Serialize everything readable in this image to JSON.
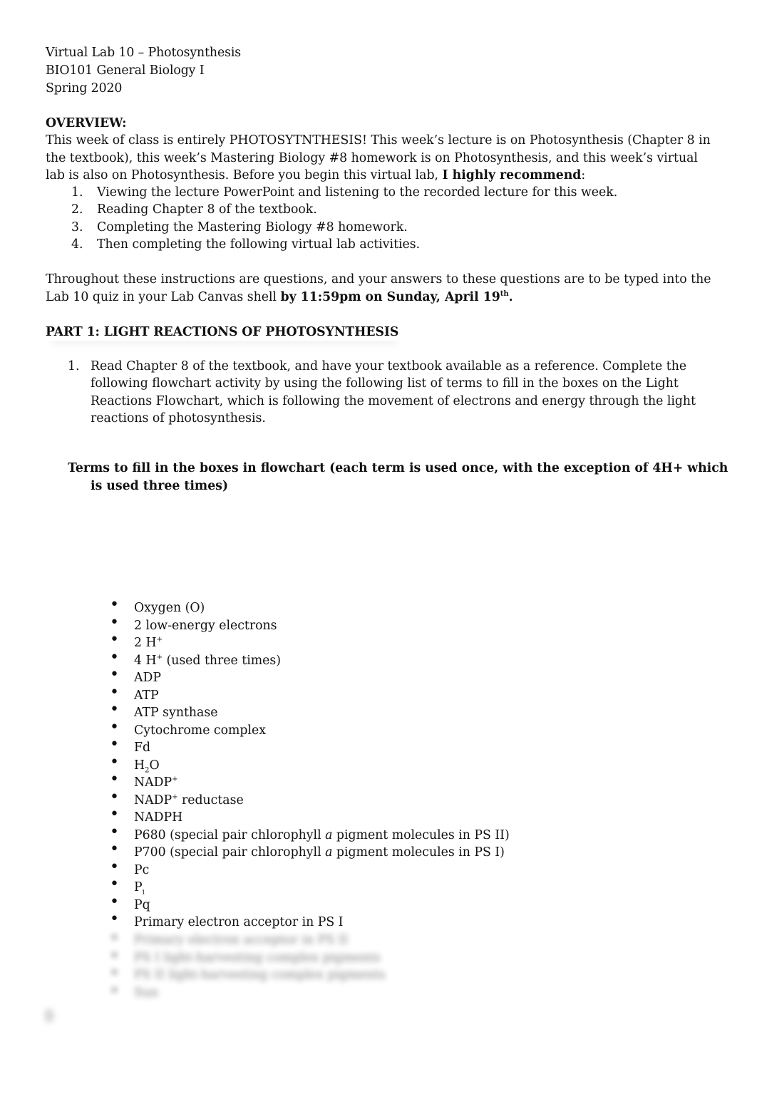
{
  "header": {
    "title": "Virtual Lab 10 – Photosynthesis",
    "course": "BIO101 General Biology I",
    "term": "Spring 2020"
  },
  "overview": {
    "heading": "OVERVIEW:",
    "intro_text": "This week of class is entirely PHOTOSYTNTHESIS! This week’s lecture is on Photosynthesis (Chapter 8 in the textbook), this week’s Mastering Biology #8 homework is on Photosynthesis, and this week’s virtual lab is also on Photosynthesis.  Before you begin this virtual lab, ",
    "intro_bold": "I highly recommend",
    "intro_end": ":",
    "steps": [
      {
        "num": "1.",
        "text": "Viewing the lecture PowerPoint and listening to the recorded lecture for this week."
      },
      {
        "num": "2.",
        "text": "Reading Chapter 8 of the textbook."
      },
      {
        "num": "3.",
        "text": "Completing the Mastering Biology #8 homework."
      },
      {
        "num": "4.",
        "text": "Then completing the following virtual lab activities."
      }
    ],
    "deadline_text": "Throughout these instructions are questions, and your answers to these questions are to be typed into the Lab 10 quiz in your Lab Canvas shell ",
    "deadline_bold": "by 11:59pm on Sunday, April 19",
    "deadline_sup": "th",
    "deadline_end": "."
  },
  "part1": {
    "heading": "PART 1: LIGHT REACTIONS OF PHOTOSYNTHESIS",
    "question": {
      "num": "1.",
      "text": "Read Chapter 8 of the textbook, and have your textbook available as a reference.  Complete the following flowchart activity by using the following list of terms to fill in the boxes on the Light Reactions Flowchart, which is following the movement of electrons and energy through the light reactions of photosynthesis."
    },
    "terms_heading": "Terms to fill in the boxes in flowchart (each term is used once, with the exception of 4H+ which is used three times)",
    "terms": [
      {
        "base": "Oxygen (O)"
      },
      {
        "base": "2 low-energy electrons"
      },
      {
        "base": "2 H",
        "sup": "+"
      },
      {
        "base": "4 H",
        "sup": "+",
        "rest": " (used three times)"
      },
      {
        "base": "ADP"
      },
      {
        "base": "ATP"
      },
      {
        "base": "ATP synthase"
      },
      {
        "base": "Cytochrome complex"
      },
      {
        "base": "Fd"
      },
      {
        "base": "H",
        "sub": "2",
        "rest": "O"
      },
      {
        "base": "NADP",
        "sup": "+"
      },
      {
        "base": "NADP",
        "sup": "+",
        "rest": " reductase"
      },
      {
        "base": "NADPH"
      },
      {
        "base": "P680 (special pair chlorophyll ",
        "ital": "a",
        "rest": " pigment molecules in PS II)"
      },
      {
        "base": "P700 (special pair chlorophyll ",
        "ital": "a",
        "rest": " pigment molecules in PS I)"
      },
      {
        "base": "Pc"
      },
      {
        "base": "P",
        "sub": "i"
      },
      {
        "base": "Pq"
      },
      {
        "base": "Primary electron acceptor in PS I"
      }
    ],
    "blurred_terms": [
      "Primary electron acceptor in PS II",
      "PS I light-harvesting complex pigments",
      "PS II light-harvesting complex pigments",
      "Sun"
    ]
  }
}
